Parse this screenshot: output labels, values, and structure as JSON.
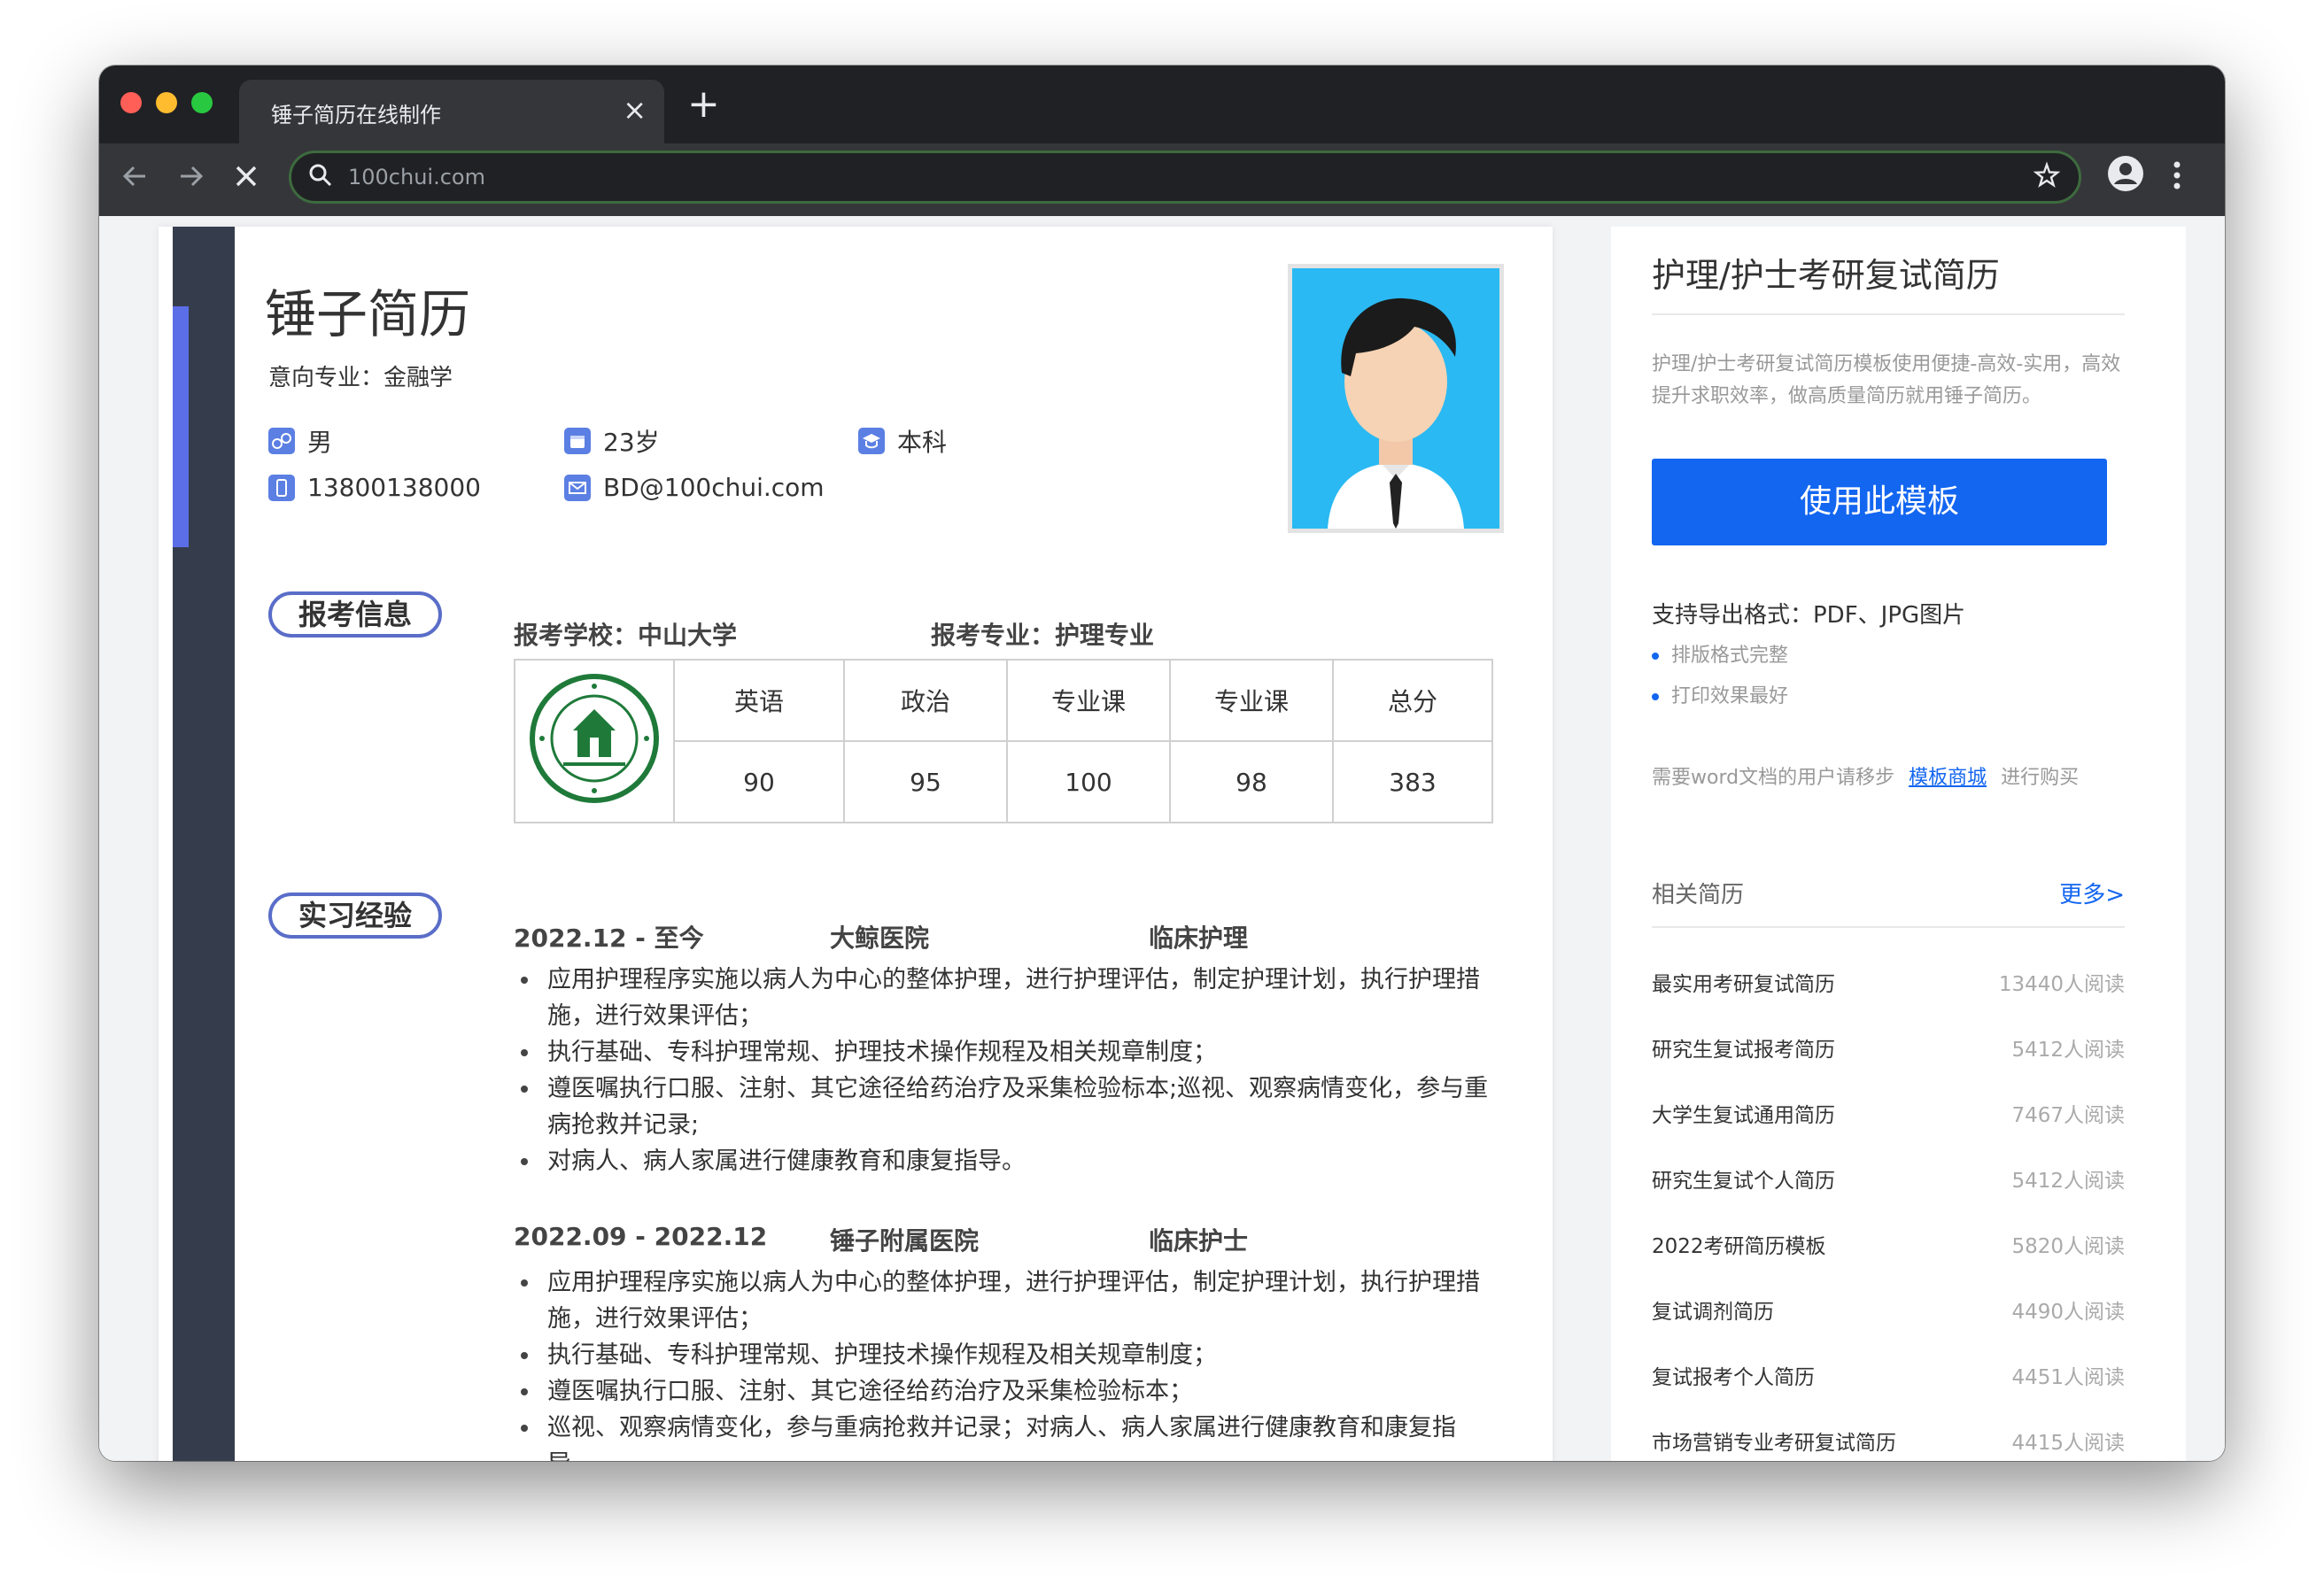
{
  "browser": {
    "tab_title": "锤子简历在线制作",
    "tab_close": "×",
    "new_tab": "+",
    "url": "100chui.com"
  },
  "resume": {
    "name": "锤子简历",
    "major_line": "意向专业：金融学",
    "info": {
      "gender": "男",
      "age": "23岁",
      "degree": "本科",
      "phone": "13800138000",
      "email": "BD@100chui.com"
    },
    "sections": {
      "exam": "报考信息",
      "internship": "实习经验"
    },
    "exam": {
      "school": "报考学校：中山大学",
      "major": "报考专业：护理专业",
      "headers": [
        "英语",
        "政治",
        "专业课",
        "专业课",
        "总分"
      ],
      "scores": [
        "90",
        "95",
        "100",
        "98",
        "383"
      ]
    },
    "experiences": [
      {
        "period": "2022.12 - 至今",
        "org": "大鲸医院",
        "role": "临床护理",
        "items": [
          "应用护理程序实施以病人为中心的整体护理，进行护理评估，制定护理计划，执行护理措施，进行效果评估；",
          "执行基础、专科护理常规、护理技术操作规程及相关规章制度；",
          "遵医嘱执行口服、注射、其它途径给药治疗及采集检验标本;巡视、观察病情变化，参与重病抢救并记录;",
          "对病人、病人家属进行健康教育和康复指导。"
        ]
      },
      {
        "period": "2022.09 - 2022.12",
        "org": "锤子附属医院",
        "role": "临床护士",
        "items": [
          "应用护理程序实施以病人为中心的整体护理，进行护理评估，制定护理计划，执行护理措施，进行效果评估；",
          "执行基础、专科护理常规、护理技术操作规程及相关规章制度；",
          "遵医嘱执行口服、注射、其它途径给药治疗及采集检验标本；",
          "巡视、观察病情变化，参与重病抢救并记录；对病人、病人家属进行健康教育和康复指导。"
        ]
      }
    ]
  },
  "sidebar": {
    "title": "护理/护士考研复试简历",
    "description": "护理/护士考研复试简历模板使用便捷-高效-实用，高效提升求职效率，做高质量简历就用锤子简历。",
    "use_button": "使用此模板",
    "export_formats": "支持导出格式：PDF、JPG图片",
    "features": [
      "排版格式完整",
      "打印效果最好"
    ],
    "word_note_prefix": "需要word文档的用户请移步",
    "word_note_link": "模板商城",
    "word_note_suffix": "进行购买",
    "related_title": "相关简历",
    "more_link": "更多>",
    "related": [
      {
        "title": "最实用考研复试简历",
        "reads": "13440人阅读"
      },
      {
        "title": "研究生复试报考简历",
        "reads": "5412人阅读"
      },
      {
        "title": "大学生复试通用简历",
        "reads": "7467人阅读"
      },
      {
        "title": "研究生复试个人简历",
        "reads": "5412人阅读"
      },
      {
        "title": "2022考研简历模板",
        "reads": "5820人阅读"
      },
      {
        "title": "复试调剂简历",
        "reads": "4490人阅读"
      },
      {
        "title": "复试报考个人简历",
        "reads": "4451人阅读"
      },
      {
        "title": "市场营销专业考研复试简历",
        "reads": "4415人阅读"
      }
    ]
  },
  "colors": {
    "accent_blue": "#1366f0",
    "resume_sidebar": "#353d4d",
    "section_border": "#5a6dc8",
    "photo_bg": "#2ab9f2",
    "logo_green": "#1f7a3a"
  }
}
